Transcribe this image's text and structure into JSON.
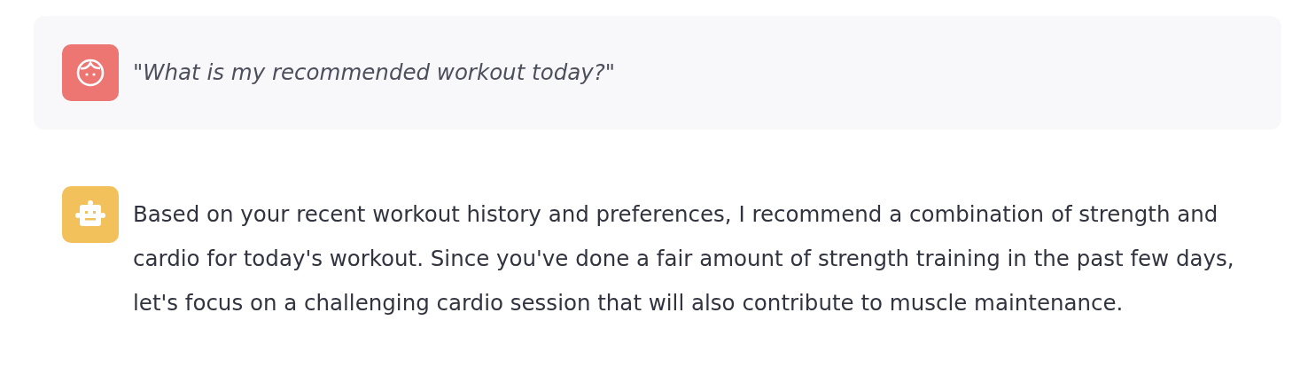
{
  "messages": [
    {
      "kind": "user",
      "text": "\"What is my recommended workout today?\""
    },
    {
      "kind": "assistant",
      "text": "Based on your recent workout history and preferences, I recommend a combination of strength and cardio for today's workout. Since you've done a fair amount of strength training in the past few days, let's focus on a challenging cardio session that will also contribute to muscle maintenance."
    }
  ]
}
